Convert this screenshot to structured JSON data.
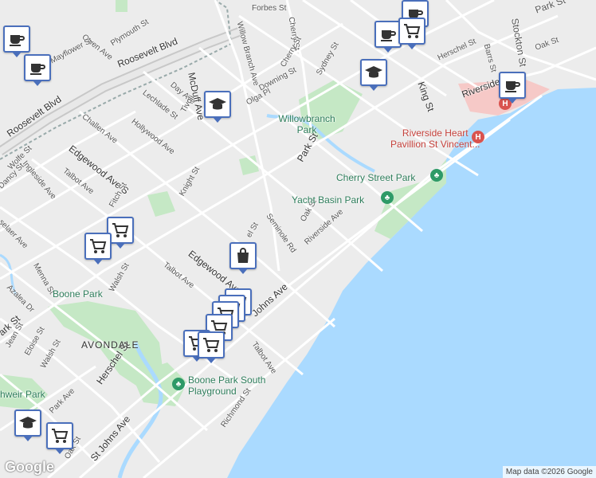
{
  "map": {
    "streets": [
      {
        "id": "forbes-st",
        "text": "Forbes St"
      },
      {
        "id": "cherry-st-n",
        "text": "Cherry St"
      },
      {
        "id": "park-st-ne",
        "text": "Park St"
      },
      {
        "id": "stockton-st",
        "text": "Stockton St"
      },
      {
        "id": "owen-ave",
        "text": "Owen Ave"
      },
      {
        "id": "plymouth-st",
        "text": "Plymouth St"
      },
      {
        "id": "willow-branch-ave",
        "text": "Willow Branch Ave"
      },
      {
        "id": "oak-st-ne",
        "text": "Oak St"
      },
      {
        "id": "herschel-st-ne",
        "text": "Herschel St"
      },
      {
        "id": "barrs-st",
        "text": "Barrs St"
      },
      {
        "id": "mayflower-st",
        "text": "Mayflower St"
      },
      {
        "id": "roosevelt-blvd-top",
        "text": "Roosevelt Blvd"
      },
      {
        "id": "mcduff-ave",
        "text": "McDuff Ave"
      },
      {
        "id": "cherry-st-mid",
        "text": "Cherry St"
      },
      {
        "id": "sydney-st",
        "text": "Sydney St"
      },
      {
        "id": "king-st",
        "text": "King St"
      },
      {
        "id": "riverside-ne",
        "text": "Riverside"
      },
      {
        "id": "day-ave",
        "text": "Day Ave"
      },
      {
        "id": "downing-st",
        "text": "Downing St"
      },
      {
        "id": "lechlade-st",
        "text": "Lechlade St"
      },
      {
        "id": "tivoli",
        "text": "Tivoli"
      },
      {
        "id": "olga-pl",
        "text": "Olga Pl"
      },
      {
        "id": "roosevelt-blvd-left",
        "text": "Roosevelt Blvd"
      },
      {
        "id": "challen-ave",
        "text": "Challen Ave"
      },
      {
        "id": "hollywood-ave",
        "text": "Hollywood Ave"
      },
      {
        "id": "edgewood-ave-s",
        "text": "Edgewood Ave S"
      },
      {
        "id": "park-st-mid",
        "text": "Park St"
      },
      {
        "id": "ingleside-ave",
        "text": "Ingleside Ave"
      },
      {
        "id": "wolfe-st",
        "text": "Wolfe St"
      },
      {
        "id": "talbot-ave-n",
        "text": "Talbot Ave"
      },
      {
        "id": "dancy-st",
        "text": "Dancy St"
      },
      {
        "id": "knight-st",
        "text": "Knight St"
      },
      {
        "id": "fitch-st",
        "text": "Fitch St"
      },
      {
        "id": "selaer-ave",
        "text": "selaer Ave"
      },
      {
        "id": "seminole-rd",
        "text": "Seminole Rd"
      },
      {
        "id": "oak-st-mid",
        "text": "Oak St"
      },
      {
        "id": "riverside-ave",
        "text": "Riverside Ave"
      },
      {
        "id": "el-st",
        "text": "el St"
      },
      {
        "id": "edgewood-ave",
        "text": "Edgewood Ave"
      },
      {
        "id": "talbot-ave-mid",
        "text": "Talbot Ave"
      },
      {
        "id": "menna-st",
        "text": "Menna St"
      },
      {
        "id": "walsh-st-n",
        "text": "Walsh St"
      },
      {
        "id": "azalea-dr",
        "text": "Azalea Dr"
      },
      {
        "id": "johns-ave",
        "text": "Johns Ave"
      },
      {
        "id": "ark-st",
        "text": "ark St"
      },
      {
        "id": "jean-st",
        "text": "Jean St"
      },
      {
        "id": "eloise-st",
        "text": "Eloise St"
      },
      {
        "id": "walsh-st-s",
        "text": "Walsh St"
      },
      {
        "id": "herschel-st-sw",
        "text": "Herschel St"
      },
      {
        "id": "talbot-ave-s",
        "text": "Talbot Ave"
      },
      {
        "id": "park-ave",
        "text": "Park Ave"
      },
      {
        "id": "richmond-st",
        "text": "Richmond St"
      },
      {
        "id": "oak-st-sw",
        "text": "Oak St"
      },
      {
        "id": "st-johns-ave",
        "text": "St Johns Ave"
      }
    ],
    "parks": [
      {
        "id": "willowbranch-park",
        "text": "Willowbranch\nPark"
      },
      {
        "id": "cherry-street-park",
        "text": "Cherry Street Park"
      },
      {
        "id": "yacht-basin-park",
        "text": "Yacht Basin Park"
      },
      {
        "id": "boone-park",
        "text": "Boone Park"
      },
      {
        "id": "boone-park-south",
        "text": "Boone Park South\nPlayground"
      },
      {
        "id": "shweir-park",
        "text": "hweir Park"
      }
    ],
    "hospital": {
      "text": "Riverside Heart\nPavillion St Vincent..."
    },
    "neighborhood": {
      "text": "AVONDALE"
    },
    "logo": "Google",
    "attribution": "Map data ©2026 Google",
    "colors": {
      "water": "#aadaff",
      "park": "#c5e8c5",
      "road": "#ffffff",
      "major_road": "#c8c8c8",
      "marker_border": "#4a6fbb",
      "hospital": "#f6c9c7"
    },
    "markers": [
      {
        "id": "cafe-1",
        "icon": "coffee-cup-icon"
      },
      {
        "id": "cafe-2",
        "icon": "coffee-cup-icon"
      },
      {
        "id": "cafe-3",
        "icon": "coffee-cup-icon"
      },
      {
        "id": "cafe-4",
        "icon": "coffee-cup-icon"
      },
      {
        "id": "cafe-5",
        "icon": "coffee-cup-icon"
      },
      {
        "id": "cafe-6",
        "icon": "coffee-cup-icon"
      },
      {
        "id": "grocery-1",
        "icon": "shopping-cart-icon"
      },
      {
        "id": "grocery-2",
        "icon": "shopping-cart-icon"
      },
      {
        "id": "grocery-3",
        "icon": "shopping-cart-icon"
      },
      {
        "id": "grocery-4",
        "icon": "shopping-cart-icon"
      },
      {
        "id": "grocery-5",
        "icon": "shopping-cart-icon"
      },
      {
        "id": "grocery-6",
        "icon": "shopping-cart-icon"
      },
      {
        "id": "grocery-7",
        "icon": "shopping-cart-icon"
      },
      {
        "id": "grocery-8",
        "icon": "shopping-cart-icon"
      },
      {
        "id": "grocery-9",
        "icon": "shopping-cart-icon"
      },
      {
        "id": "school-1",
        "icon": "graduation-cap-icon"
      },
      {
        "id": "school-2",
        "icon": "graduation-cap-icon"
      },
      {
        "id": "school-3",
        "icon": "graduation-cap-icon"
      },
      {
        "id": "store-1",
        "icon": "shopping-bag-icon"
      }
    ]
  }
}
